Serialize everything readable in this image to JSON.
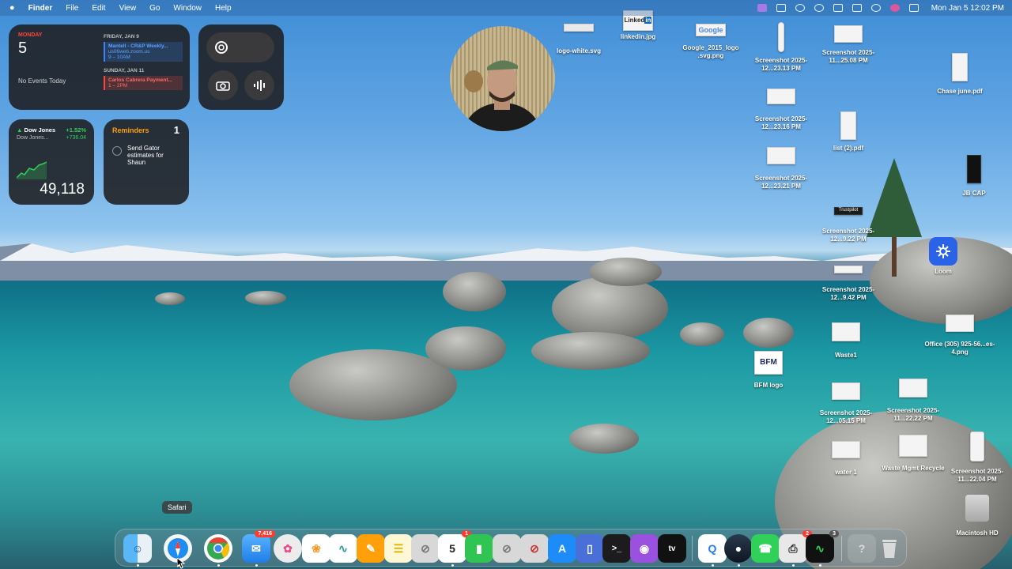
{
  "menubar": {
    "apple": "",
    "app": "Finder",
    "menus": [
      "File",
      "Edit",
      "View",
      "Go",
      "Window",
      "Help"
    ],
    "datetime": "Mon Jan 5  12:02 PM"
  },
  "calendar_widget": {
    "day_label": "MONDAY",
    "day_num": "5",
    "no_events": "No Events Today",
    "friday_header": "FRIDAY, JAN 9",
    "friday_event": {
      "title": "Mantell - CR&P Weekly...",
      "detail": "us06web.zoom.us",
      "time": "9 – 10AM"
    },
    "sunday_header": "SUNDAY, JAN 11",
    "sunday_event": {
      "title": "Carlos Cabrera Payment...",
      "time": "1 – 2PM"
    }
  },
  "stocks_widget": {
    "name": "Dow Jones",
    "pct": "+1.52%",
    "sub": "Dow Jones...",
    "change": "+736.04",
    "value": "49,118"
  },
  "reminders_widget": {
    "title": "Reminders",
    "count": "1",
    "item": "Send Gator estimates for Shaun"
  },
  "desktop_icons": [
    {
      "label": "logo-white.svg"
    },
    {
      "label": "linkedin.jpg"
    },
    {
      "label": "Google_2015_logo .svg.png"
    },
    {
      "label": "Screenshot 2025-12...23.13 PM"
    },
    {
      "label": "Screenshot 2025-11...25.08 PM"
    },
    {
      "label": "Chase june.pdf"
    },
    {
      "label": "Screenshot 2025-12...23.16 PM"
    },
    {
      "label": "list (2).pdf"
    },
    {
      "label": "Screenshot 2025-12...23.21 PM"
    },
    {
      "label": "JB CAP"
    },
    {
      "label": "Screenshot 2025-12...9.22 PM"
    },
    {
      "label": "Loom"
    },
    {
      "label": "Screenshot 2025-12...9.42 PM"
    },
    {
      "label": "Waste1"
    },
    {
      "label": "Office (305) 925-56...es-4.png"
    },
    {
      "label": "BFM logo"
    },
    {
      "label": "Screenshot 2025-12...05.15 PM"
    },
    {
      "label": "Screenshot 2025-11...22.22 PM"
    },
    {
      "label": "water 1"
    },
    {
      "label": "Waste Mgmt Recycle"
    },
    {
      "label": "Screenshot 2025-11...22.04 PM"
    },
    {
      "label": "Macintosh HD"
    }
  ],
  "thumb_text": {
    "linkedin": "Linked",
    "linkedin_in": "in",
    "google": "Google",
    "trustpilot": "Trustpilot",
    "bfm": "BFM"
  },
  "dock": {
    "tooltip": "Safari",
    "mail_badge": "7,416",
    "calendar_badge": "1",
    "calendar_day": "5",
    "printer_badge": "2",
    "activity_badge": "3",
    "help_glyph": "?",
    "tv_label": "tv"
  },
  "colors": {
    "calendar_red": "#ff453a",
    "reminder_orange": "#ff9f0a",
    "stock_green": "#30d158",
    "event_blue": "#5aa2ff"
  }
}
